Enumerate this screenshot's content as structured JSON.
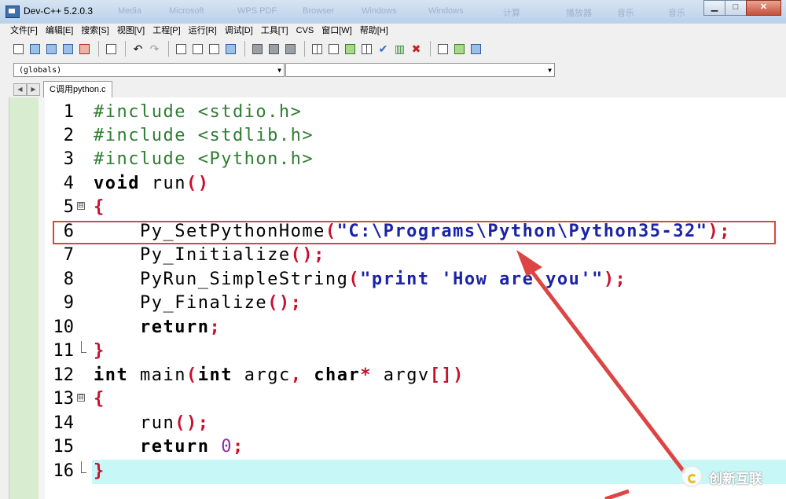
{
  "window": {
    "title": "Dev-C++ 5.2.0.3",
    "minimize": "▁",
    "maximize": "□",
    "close": "✕"
  },
  "background_titles": [
    "Media",
    "Microsoft",
    "WPS PDF",
    "Browser",
    "Windows",
    "Windows",
    "计算",
    "播放器",
    "音乐",
    "音乐"
  ],
  "menu": [
    "文件[F]",
    "编辑[E]",
    "搜索[S]",
    "视图[V]",
    "工程[P]",
    "运行[R]",
    "调试[D]",
    "工具[T]",
    "CVS",
    "窗口[W]",
    "帮助[H]"
  ],
  "combos": {
    "scope": "(globals)",
    "member": ""
  },
  "tabs": {
    "file": "C调用python.c",
    "prev": "◀",
    "next": "▶"
  },
  "editor": {
    "lines": [
      {
        "n": "1"
      },
      {
        "n": "2"
      },
      {
        "n": "3"
      },
      {
        "n": "4"
      },
      {
        "n": "5"
      },
      {
        "n": "6"
      },
      {
        "n": "7"
      },
      {
        "n": "8"
      },
      {
        "n": "9"
      },
      {
        "n": "10"
      },
      {
        "n": "11"
      },
      {
        "n": "12"
      },
      {
        "n": "13"
      },
      {
        "n": "14"
      },
      {
        "n": "15"
      },
      {
        "n": "16"
      }
    ],
    "code": {
      "l1": "#include <stdio.h>",
      "l2": "#include <stdlib.h>",
      "l3": "#include <Python.h>",
      "l4_kw": "void",
      "l4_name": " run",
      "l4_sym": "()",
      "l5": "{",
      "l6_fn": "    Py_SetPythonHome",
      "l6_open": "(",
      "l6_str": "\"C:\\Programs\\Python\\Python35-32\"",
      "l6_close": ");",
      "l7_fn": "    Py_Initialize",
      "l7_sym": "();",
      "l8_fn": "    PyRun_SimpleString",
      "l8_open": "(",
      "l8_str": "\"print 'How are you'\"",
      "l8_close": ");",
      "l9_fn": "    Py_Finalize",
      "l9_sym": "();",
      "l10_indent": "    ",
      "l10_kw": "return",
      "l10_sym": ";",
      "l11": "}",
      "l12_kw1": "int",
      "l12_a": " main",
      "l12_s1": "(",
      "l12_kw2": "int",
      "l12_b": " argc",
      "l12_s2": ",",
      "l12_c": " ",
      "l12_kw3": "char",
      "l12_s3": "*",
      "l12_d": " argv",
      "l12_s4": "[])",
      "l13": "{",
      "l14_fn": "    run",
      "l14_sym": "();",
      "l15_indent": "    ",
      "l15_kw": "return",
      "l15_sp": " ",
      "l15_num": "0",
      "l15_sym": ";",
      "l16": "}"
    },
    "fold_open": "⊟"
  },
  "watermark": {
    "text": "创新互联"
  },
  "colors": {
    "annotation": "#dd4444",
    "active_line": "#c8f7f7",
    "gutter_left": "#d8ecd0"
  }
}
